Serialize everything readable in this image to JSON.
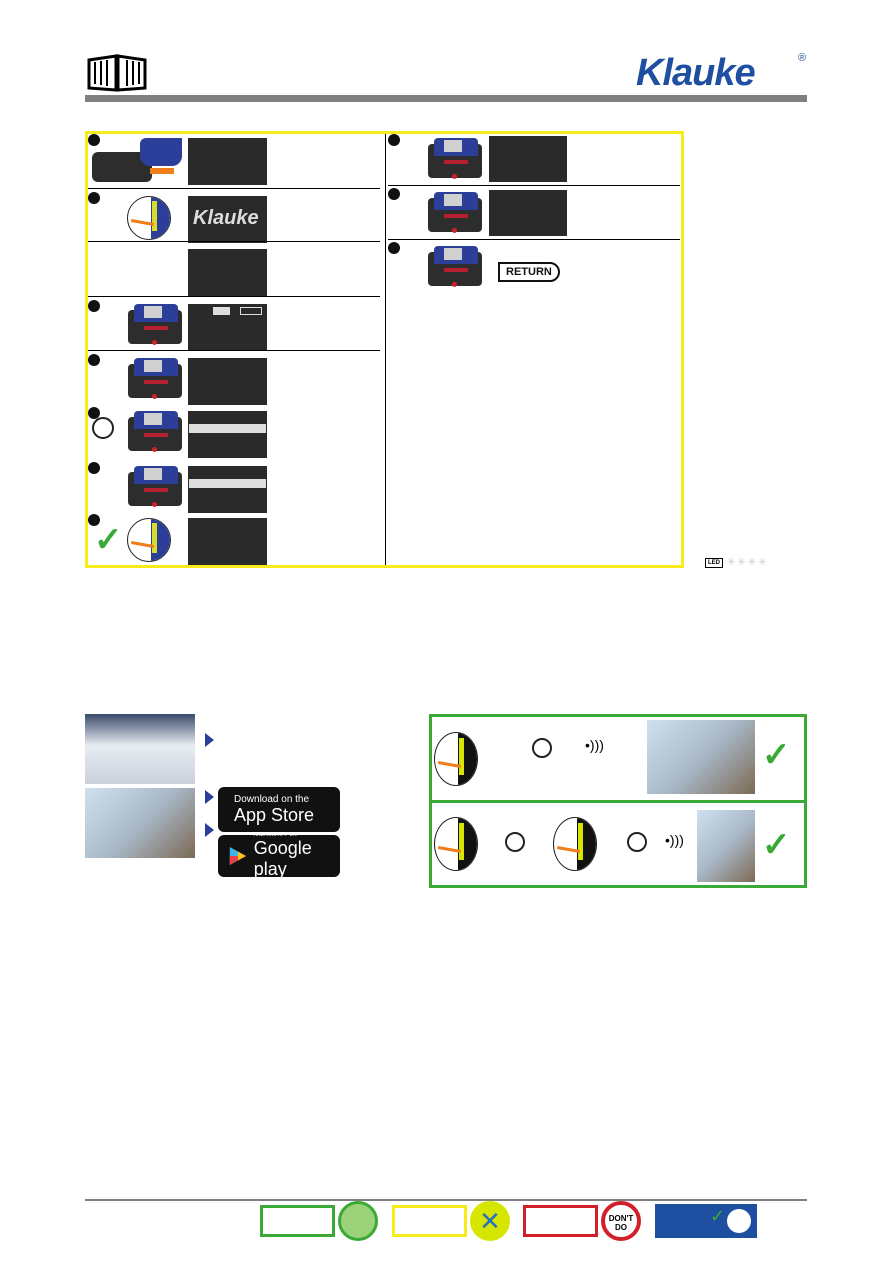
{
  "header": {
    "brand": "Klauke",
    "registered": "®",
    "manual_icon": "open-book-icon"
  },
  "steps_left": [
    {
      "screen": "blank"
    },
    {
      "screen": "logo",
      "logo": "Klauke"
    },
    {
      "screen": "blank"
    },
    {
      "screen": "battery"
    },
    {
      "screen": "blank"
    },
    {
      "screen": "highlight"
    },
    {
      "screen": "highlight"
    },
    {
      "screen": "blank"
    }
  ],
  "steps_right": [
    {
      "screen": "blank"
    },
    {
      "screen": "blank"
    },
    {
      "return_label": "RETURN"
    }
  ],
  "led_legend": {
    "icon": "led-flashlight-icon",
    "label": "LED"
  },
  "app": {
    "appstore_small": "Download on the",
    "appstore_big": "App Store",
    "googleplay_small": "ANDROID APP ON",
    "googleplay_big": "Google play"
  },
  "footer": {
    "dont_do": "DON'T DO",
    "colors": {
      "green": "#3aa935",
      "yellow": "#f7ec1a",
      "red": "#d2202a",
      "blue": "#1f4fa0"
    }
  }
}
